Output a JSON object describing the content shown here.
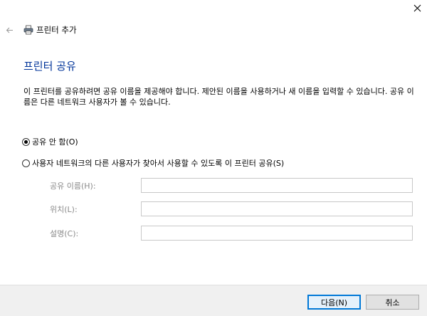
{
  "window": {
    "close_icon": "close-icon"
  },
  "header": {
    "back_icon": "back-arrow-icon",
    "printer_icon": "printer-icon",
    "title": "프린터 추가"
  },
  "main": {
    "heading": "프린터 공유",
    "description": "이 프린터를 공유하려면 공유 이름을 제공해야 합니다. 제안된 이름을 사용하거나 새 이름을 입력할 수 있습니다. 공유 이름은 다른 네트워크 사용자가 볼 수 있습니다.",
    "options": [
      {
        "label": "공유 안 함(O)",
        "checked": true
      },
      {
        "label": "사용자 네트워크의 다른 사용자가 찾아서 사용할 수 있도록 이 프린터 공유(S)",
        "checked": false
      }
    ],
    "fields": {
      "share_name": {
        "label": "공유 이름(H):",
        "value": ""
      },
      "location": {
        "label": "위치(L):",
        "value": ""
      },
      "comment": {
        "label": "설명(C):",
        "value": ""
      }
    }
  },
  "footer": {
    "next_label": "다음(N)",
    "cancel_label": "취소"
  },
  "colors": {
    "heading": "#003399",
    "accent": "#0078d7",
    "footer_bg": "#f0f0f0",
    "disabled_label": "#8a8a8a"
  }
}
